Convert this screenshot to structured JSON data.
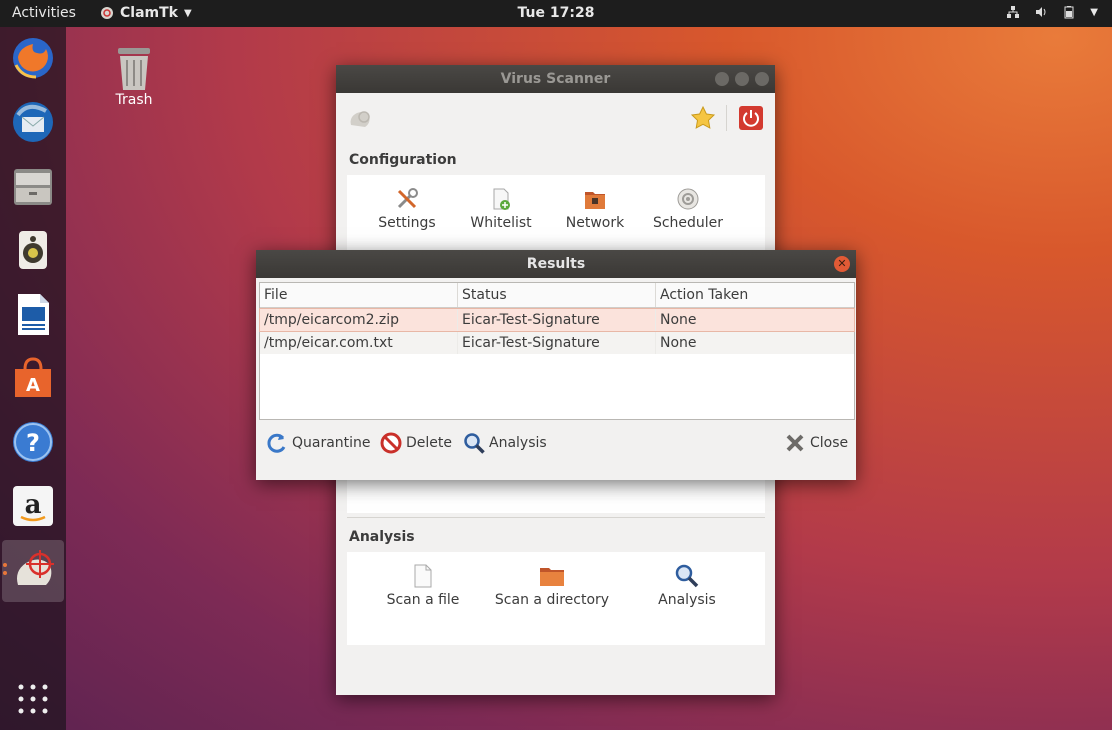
{
  "topbar": {
    "activities": "Activities",
    "app_name": "ClamTk",
    "clock": "Tue 17:28"
  },
  "desktop": {
    "trash_label": "Trash"
  },
  "dock": {
    "items": [
      "firefox-icon",
      "thunderbird-icon",
      "files-icon",
      "rhythmbox-icon",
      "writer-icon",
      "software-icon",
      "help-icon",
      "amazon-icon",
      "clamtk-icon"
    ]
  },
  "virus_scanner": {
    "title": "Virus Scanner",
    "configuration_title": "Configuration",
    "config_tools": [
      {
        "label": "Settings",
        "icon": "settings-tools-icon"
      },
      {
        "label": "Whitelist",
        "icon": "whitelist-icon"
      },
      {
        "label": "Network",
        "icon": "network-icon"
      },
      {
        "label": "Scheduler",
        "icon": "scheduler-icon"
      }
    ],
    "analysis_title": "Analysis",
    "analysis_tools": [
      {
        "label": "Scan a file",
        "icon": "file-icon"
      },
      {
        "label": "Scan a directory",
        "icon": "folder-icon"
      },
      {
        "label": "Analysis",
        "icon": "magnifier-icon"
      }
    ]
  },
  "results": {
    "title": "Results",
    "columns": [
      "File",
      "Status",
      "Action Taken"
    ],
    "rows": [
      {
        "file": "/tmp/eicarcom2.zip",
        "status": "Eicar-Test-Signature",
        "action": "None"
      },
      {
        "file": "/tmp/eicar.com.txt",
        "status": "Eicar-Test-Signature",
        "action": "None"
      }
    ],
    "buttons": {
      "quarantine": "Quarantine",
      "delete": "Delete",
      "analysis": "Analysis",
      "close": "Close"
    }
  },
  "colors": {
    "topbar": "#1d1d1d",
    "accent_orange": "#e8773a",
    "selected_row": "#fbe3dc"
  }
}
